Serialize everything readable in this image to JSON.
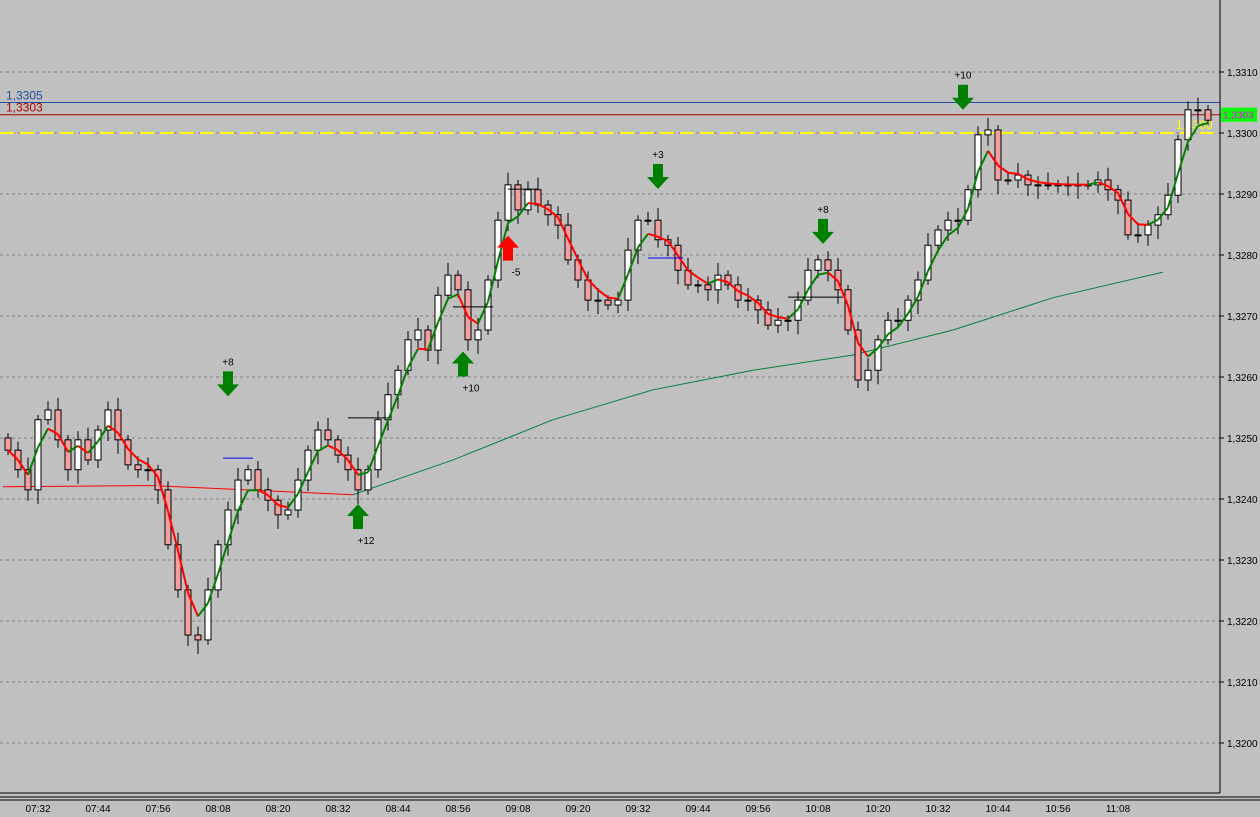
{
  "chart_data": {
    "type": "candlestick",
    "instrument_price_format": "comma-decimal",
    "bar_interval_minutes": 2,
    "start_time": "07:26",
    "closes": [
      1.3248,
      1.32448,
      1.32415,
      1.3253,
      1.32546,
      1.32497,
      1.32448,
      1.32497,
      1.32464,
      1.32513,
      1.32546,
      1.32497,
      1.32456,
      1.32448,
      1.32448,
      1.32415,
      1.32325,
      1.32251,
      1.32177,
      1.32169,
      1.32251,
      1.32325,
      1.32382,
      1.32431,
      1.32448,
      1.32415,
      1.32398,
      1.32374,
      1.32382,
      1.32431,
      1.3248,
      1.32513,
      1.32497,
      1.32472,
      1.32448,
      1.32415,
      1.32448,
      1.3253,
      1.32571,
      1.32611,
      1.32661,
      1.32677,
      1.32644,
      1.32734,
      1.32767,
      1.32743,
      1.32661,
      1.32677,
      1.32759,
      1.32857,
      1.32915,
      1.32874,
      1.32907,
      1.32882,
      1.32866,
      1.32849,
      1.32792,
      1.32759,
      1.32726,
      1.32726,
      1.32718,
      1.32726,
      1.32808,
      1.32857,
      1.32857,
      1.32825,
      1.32816,
      1.32775,
      1.32751,
      1.32751,
      1.32743,
      1.32767,
      1.32751,
      1.32726,
      1.32726,
      1.3271,
      1.32685,
      1.32693,
      1.32693,
      1.32726,
      1.32775,
      1.32792,
      1.32775,
      1.32743,
      1.32677,
      1.32595,
      1.32611,
      1.32661,
      1.32693,
      1.32693,
      1.32726,
      1.32759,
      1.32816,
      1.32841,
      1.32857,
      1.32857,
      1.32907,
      1.32997,
      1.33005,
      1.32923,
      1.32923,
      1.32931,
      1.32915,
      1.32915,
      1.32915,
      1.32915,
      1.32915,
      1.32915,
      1.32915,
      1.32923,
      1.32907,
      1.3289,
      1.32833,
      1.32833,
      1.32849,
      1.32866,
      1.32898,
      1.32989,
      1.33038,
      1.33038,
      1.33021
    ],
    "slow_ma": [
      {
        "time": "07:25",
        "value": 1.3242
      },
      {
        "time": "07:55",
        "value": 1.32422
      },
      {
        "time": "08:35",
        "value": 1.32407
      },
      {
        "time": "08:55",
        "value": 1.32464
      },
      {
        "time": "09:15",
        "value": 1.3253
      },
      {
        "time": "09:35",
        "value": 1.32579
      },
      {
        "time": "09:55",
        "value": 1.32611
      },
      {
        "time": "10:15",
        "value": 1.32636
      },
      {
        "time": "10:35",
        "value": 1.32677
      },
      {
        "time": "10:55",
        "value": 1.3273
      },
      {
        "time": "11:17",
        "value": 1.32772
      }
    ],
    "y_ticks": [
      "1,3310",
      "1,3300",
      "1,3290",
      "1,3280",
      "1,3270",
      "1,3260",
      "1,3250",
      "1,3240",
      "1,3230",
      "1,3220",
      "1,3210",
      "1,3200"
    ],
    "ylim": [
      1.319,
      1.3322
    ],
    "x_ticks": [
      "07:32",
      "07:44",
      "07:56",
      "08:08",
      "08:20",
      "08:32",
      "08:44",
      "08:56",
      "09:08",
      "09:20",
      "09:32",
      "09:44",
      "09:56",
      "10:08",
      "10:20",
      "10:32",
      "10:44",
      "10:56",
      "11:08"
    ],
    "grid": "horizontal dashed",
    "current_price_label": "1,3303",
    "levels": [
      {
        "label": "1,3305",
        "value": 1.3305,
        "color": "#1f4e9a",
        "style": "solid"
      },
      {
        "label": "1,3303",
        "value": 1.3303,
        "color": "#b00000",
        "style": "solid"
      },
      {
        "label": "1,3300",
        "value": 1.33,
        "color": "#ffff00",
        "style": "dashed"
      }
    ],
    "signals": [
      {
        "time": "08:10",
        "direction": "down",
        "color": "#008000",
        "label": "+8",
        "price": 1.3256
      },
      {
        "time": "08:36",
        "direction": "up",
        "color": "#008000",
        "label": "+12",
        "price": 1.324
      },
      {
        "time": "08:57",
        "direction": "up",
        "color": "#008000",
        "label": "+10",
        "price": 1.3265
      },
      {
        "time": "09:06",
        "direction": "up",
        "color": "#ff0000",
        "label": "-5",
        "price": 1.3284
      },
      {
        "time": "09:36",
        "direction": "down",
        "color": "#008000",
        "label": "+3",
        "price": 1.329
      },
      {
        "time": "10:09",
        "direction": "down",
        "color": "#008000",
        "label": "+8",
        "price": 1.3281
      },
      {
        "time": "10:37",
        "direction": "down",
        "color": "#008000",
        "label": "+10",
        "price": 1.3303
      }
    ],
    "marker_lines": [
      {
        "from": "08:09",
        "to": "08:15",
        "value": 1.32467,
        "color": "#0000ff"
      },
      {
        "from": "08:34",
        "to": "08:42",
        "value": 1.32533,
        "color": "#000000"
      },
      {
        "from": "08:55",
        "to": "09:03",
        "value": 1.32715,
        "color": "#000000"
      },
      {
        "from": "09:06",
        "to": "09:12",
        "value": 1.32908,
        "color": "#000000"
      },
      {
        "from": "09:34",
        "to": "09:41",
        "value": 1.32795,
        "color": "#0000ff"
      },
      {
        "from": "10:02",
        "to": "10:13",
        "value": 1.32731,
        "color": "#000000"
      }
    ],
    "colors": {
      "background": "#c0c0c0",
      "up_candle": "#ffffff",
      "down_candle": "#f4a0a0",
      "fast_up": "#008000",
      "fast_down": "#ff0000",
      "slow_ma": "#008040",
      "price_box": "#00ff00",
      "price_box_text": "#ff00ff"
    }
  }
}
